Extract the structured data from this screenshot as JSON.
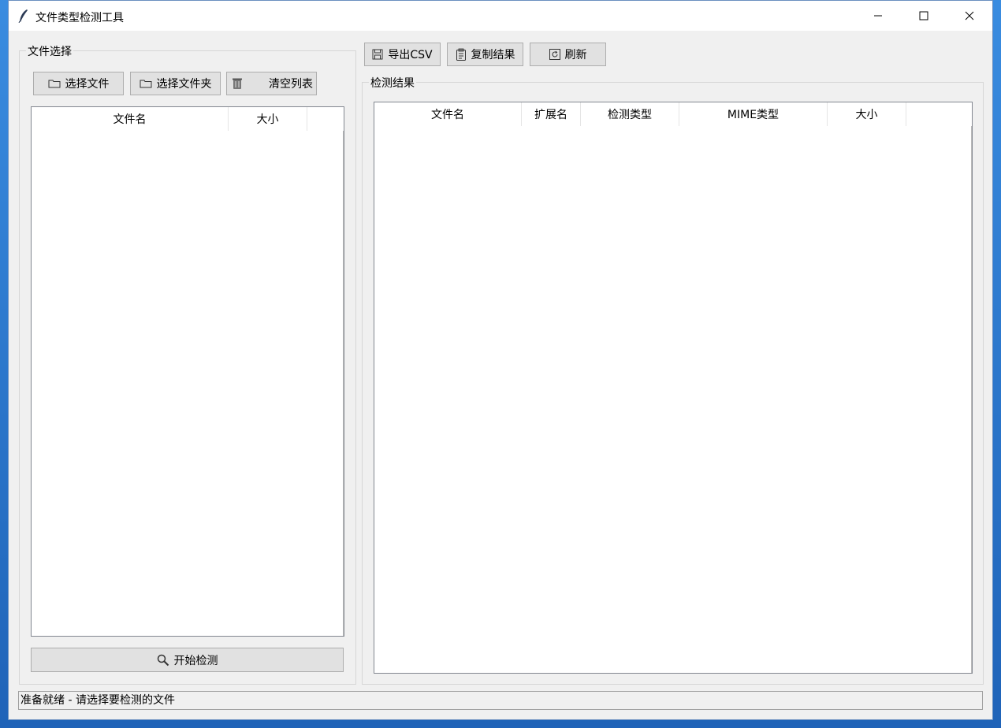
{
  "window": {
    "title": "文件类型检测工具",
    "controls": {
      "minimize_icon": "minimize-icon",
      "maximize_icon": "maximize-icon",
      "close_icon": "close-icon"
    }
  },
  "file_panel": {
    "legend": "文件选择",
    "buttons": {
      "select_file": "选择文件",
      "select_folder": "选择文件夹",
      "clear_list": "清空列表"
    },
    "columns": [
      "文件名",
      "大小"
    ],
    "rows": [],
    "start_button": "开始检测"
  },
  "toolbar": {
    "export_csv": "导出CSV",
    "copy_results": "复制结果",
    "refresh": "刷新"
  },
  "results_panel": {
    "legend": "检测结果",
    "columns": [
      "文件名",
      "扩展名",
      "检测类型",
      "MIME类型",
      "大小"
    ],
    "rows": []
  },
  "status": {
    "text": "准备就绪 - 请选择要检测的文件"
  },
  "colors": {
    "window_bg": "#f0f0f0",
    "button_bg": "#e1e1e1",
    "desktop": "#2f7fd6"
  }
}
